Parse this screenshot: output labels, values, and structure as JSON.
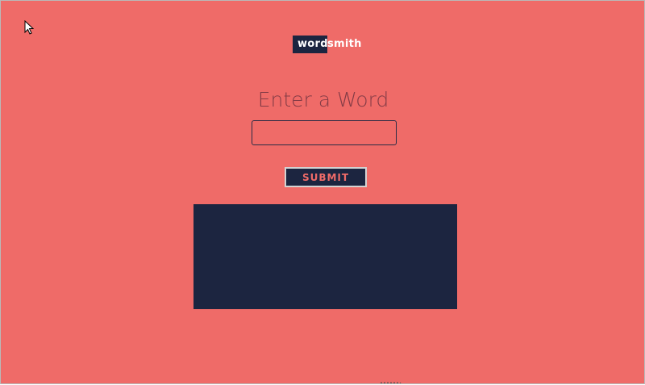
{
  "app": {
    "logo": {
      "part1": "word",
      "part2": "smith"
    }
  },
  "main": {
    "heading": "Enter a Word",
    "word_input": {
      "value": "",
      "placeholder": ""
    },
    "submit_label": "SUBMIT"
  },
  "colors": {
    "background": "#ef6b68",
    "navy": "#1c2540",
    "accent_text": "#ef6b68"
  },
  "icons": {
    "cursor": "mouse-pointer-icon"
  }
}
